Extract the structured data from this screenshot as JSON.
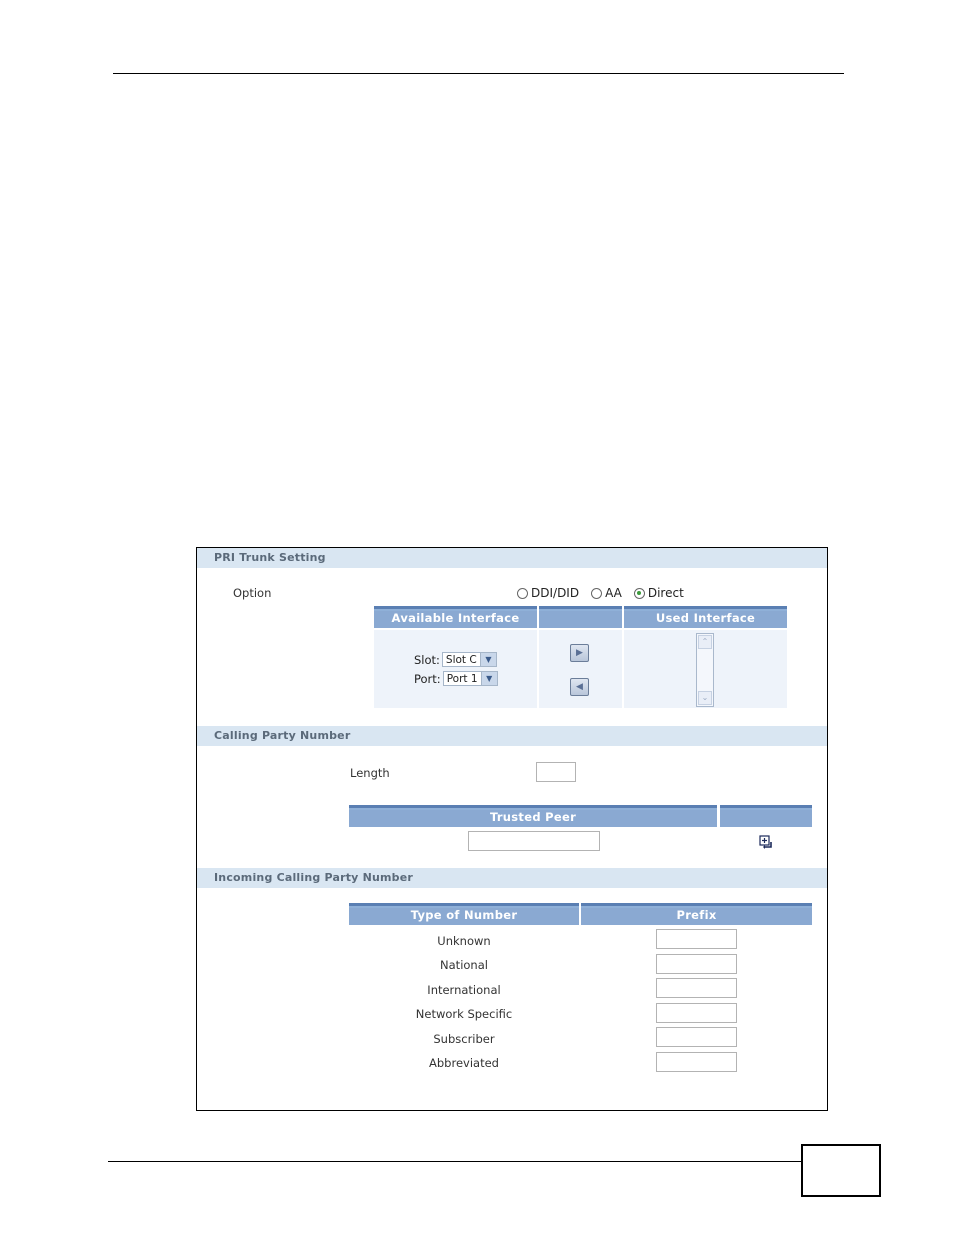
{
  "pri_trunk_setting": {
    "title": "PRI Trunk Setting",
    "option_label": "Option",
    "options": [
      {
        "label": "DDI/DID",
        "checked": false
      },
      {
        "label": "AA",
        "checked": false
      },
      {
        "label": "Direct",
        "checked": true
      }
    ],
    "interface_table": {
      "headers": [
        "Available Interface",
        "",
        "Used Interface"
      ],
      "slot_label": "Slot:",
      "slot_value": "Slot C",
      "port_label": "Port:",
      "port_value": "Port 1",
      "add_arrow_icon": "arrow-right-icon",
      "remove_arrow_icon": "arrow-left-icon",
      "used_interfaces": []
    }
  },
  "calling_party_number": {
    "title": "Calling Party Number",
    "length_label": "Length",
    "length_value": "",
    "trusted_peer_table": {
      "headers": [
        "Trusted Peer",
        ""
      ],
      "value": "",
      "add_icon": "add-entry-icon"
    }
  },
  "incoming_calling_party_number": {
    "title": "Incoming Calling Party Number",
    "headers": [
      "Type of Number",
      "Prefix"
    ],
    "rows": [
      {
        "type": "Unknown",
        "prefix": ""
      },
      {
        "type": "National",
        "prefix": ""
      },
      {
        "type": "International",
        "prefix": ""
      },
      {
        "type": "Network Specific",
        "prefix": ""
      },
      {
        "type": "Subscriber",
        "prefix": ""
      },
      {
        "type": "Abbreviated",
        "prefix": ""
      }
    ]
  },
  "colors": {
    "section_header_bg": "#d9e6f2",
    "table_header_bg": "#8aa9d2",
    "radio_checked": "#3c9a3c"
  }
}
